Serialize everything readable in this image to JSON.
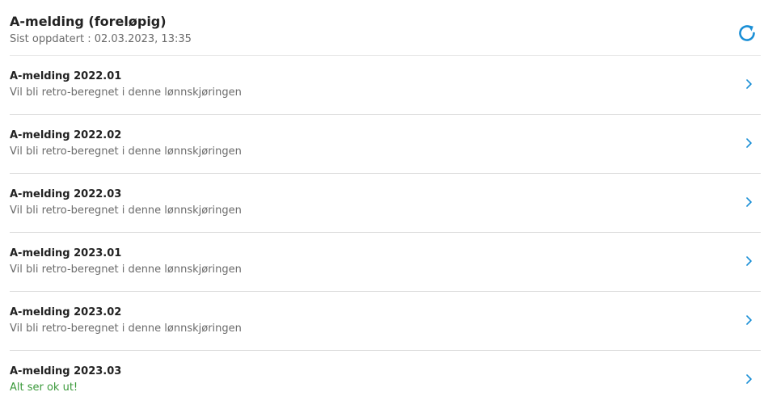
{
  "header": {
    "title": "A-melding (foreløpig)",
    "subtitle": "Sist oppdatert : 02.03.2023, 13:35",
    "refresh_icon": "refresh-icon"
  },
  "colors": {
    "accent": "#1a8fd6",
    "ok": "#3c9a3c"
  },
  "items": [
    {
      "title": "A-melding 2022.01",
      "status": "Vil bli retro-beregnet i denne lønnskjøringen"
    },
    {
      "title": "A-melding 2022.02",
      "status": "Vil bli retro-beregnet i denne lønnskjøringen"
    },
    {
      "title": "A-melding 2022.03",
      "status": "Vil bli retro-beregnet i denne lønnskjøringen"
    },
    {
      "title": "A-melding 2023.01",
      "status": "Vil bli retro-beregnet i denne lønnskjøringen"
    },
    {
      "title": "A-melding 2023.02",
      "status": "Vil bli retro-beregnet i denne lønnskjøringen"
    },
    {
      "title": "A-melding 2023.03",
      "status": "Alt ser ok ut!"
    }
  ]
}
